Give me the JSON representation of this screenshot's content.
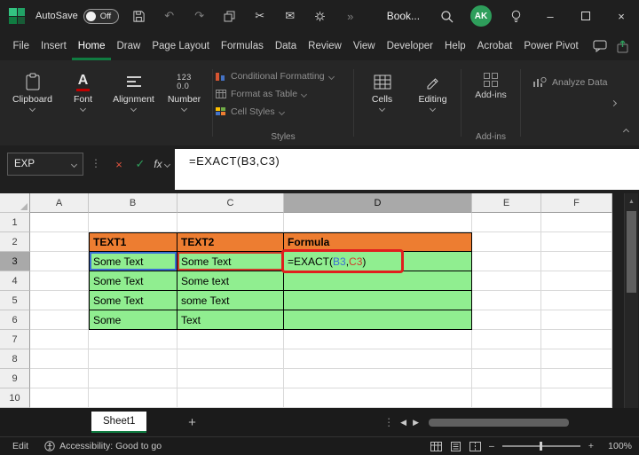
{
  "titlebar": {
    "autosave_label": "AutoSave",
    "autosave_state": "Off",
    "title": "Book...",
    "avatar_initials": "AK"
  },
  "menubar": {
    "items": [
      "File",
      "Insert",
      "Home",
      "Draw",
      "Page Layout",
      "Formulas",
      "Data",
      "Review",
      "View",
      "Developer",
      "Help",
      "Acrobat",
      "Power Pivot"
    ],
    "active_item": "Home"
  },
  "ribbon": {
    "clipboard_label": "Clipboard",
    "font_label": "Font",
    "alignment_label": "Alignment",
    "number_label": "Number",
    "styles_items": [
      "Conditional Formatting",
      "Format as Table",
      "Cell Styles"
    ],
    "styles_group_label": "Styles",
    "cells_label": "Cells",
    "editing_label": "Editing",
    "addins_label": "Add-ins",
    "addins_group_label": "Add-ins",
    "analyze_label": "Analyze Data"
  },
  "formula_bar": {
    "name_box": "EXP",
    "fx_label": "fx",
    "formula": {
      "pre": "=EXACT(",
      "ref1": "B3",
      "sep": ",",
      "ref2": "C3",
      "post": ")"
    }
  },
  "grid": {
    "col_headers": [
      "A",
      "B",
      "C",
      "D",
      "E",
      "F"
    ],
    "selected_column": "D",
    "row_headers": [
      "1",
      "2",
      "3",
      "4",
      "5",
      "6",
      "7",
      "8",
      "9",
      "10"
    ],
    "selected_row": "3",
    "cells": {
      "b2": "TEXT1",
      "c2": "TEXT2",
      "d2": "Formula",
      "b3": "Some Text",
      "c3": "Some Text",
      "b4": "Some Text",
      "c4": "Some text",
      "b5": "Some Text",
      "c5": "some Text",
      "b6": "Some",
      "c6": "Text"
    }
  },
  "sheet_tabs": {
    "active_tab": "Sheet1"
  },
  "status_bar": {
    "mode": "Edit",
    "accessibility": "Accessibility: Good to go",
    "zoom_level": "100%"
  },
  "colors": {
    "excel_green": "#107C41",
    "header_fill": "#ED7D31",
    "data_fill": "#90EE90",
    "ref1_color": "#3B6FD4",
    "ref2_color": "#D03A2B",
    "annotation_red": "#E01E1E"
  }
}
